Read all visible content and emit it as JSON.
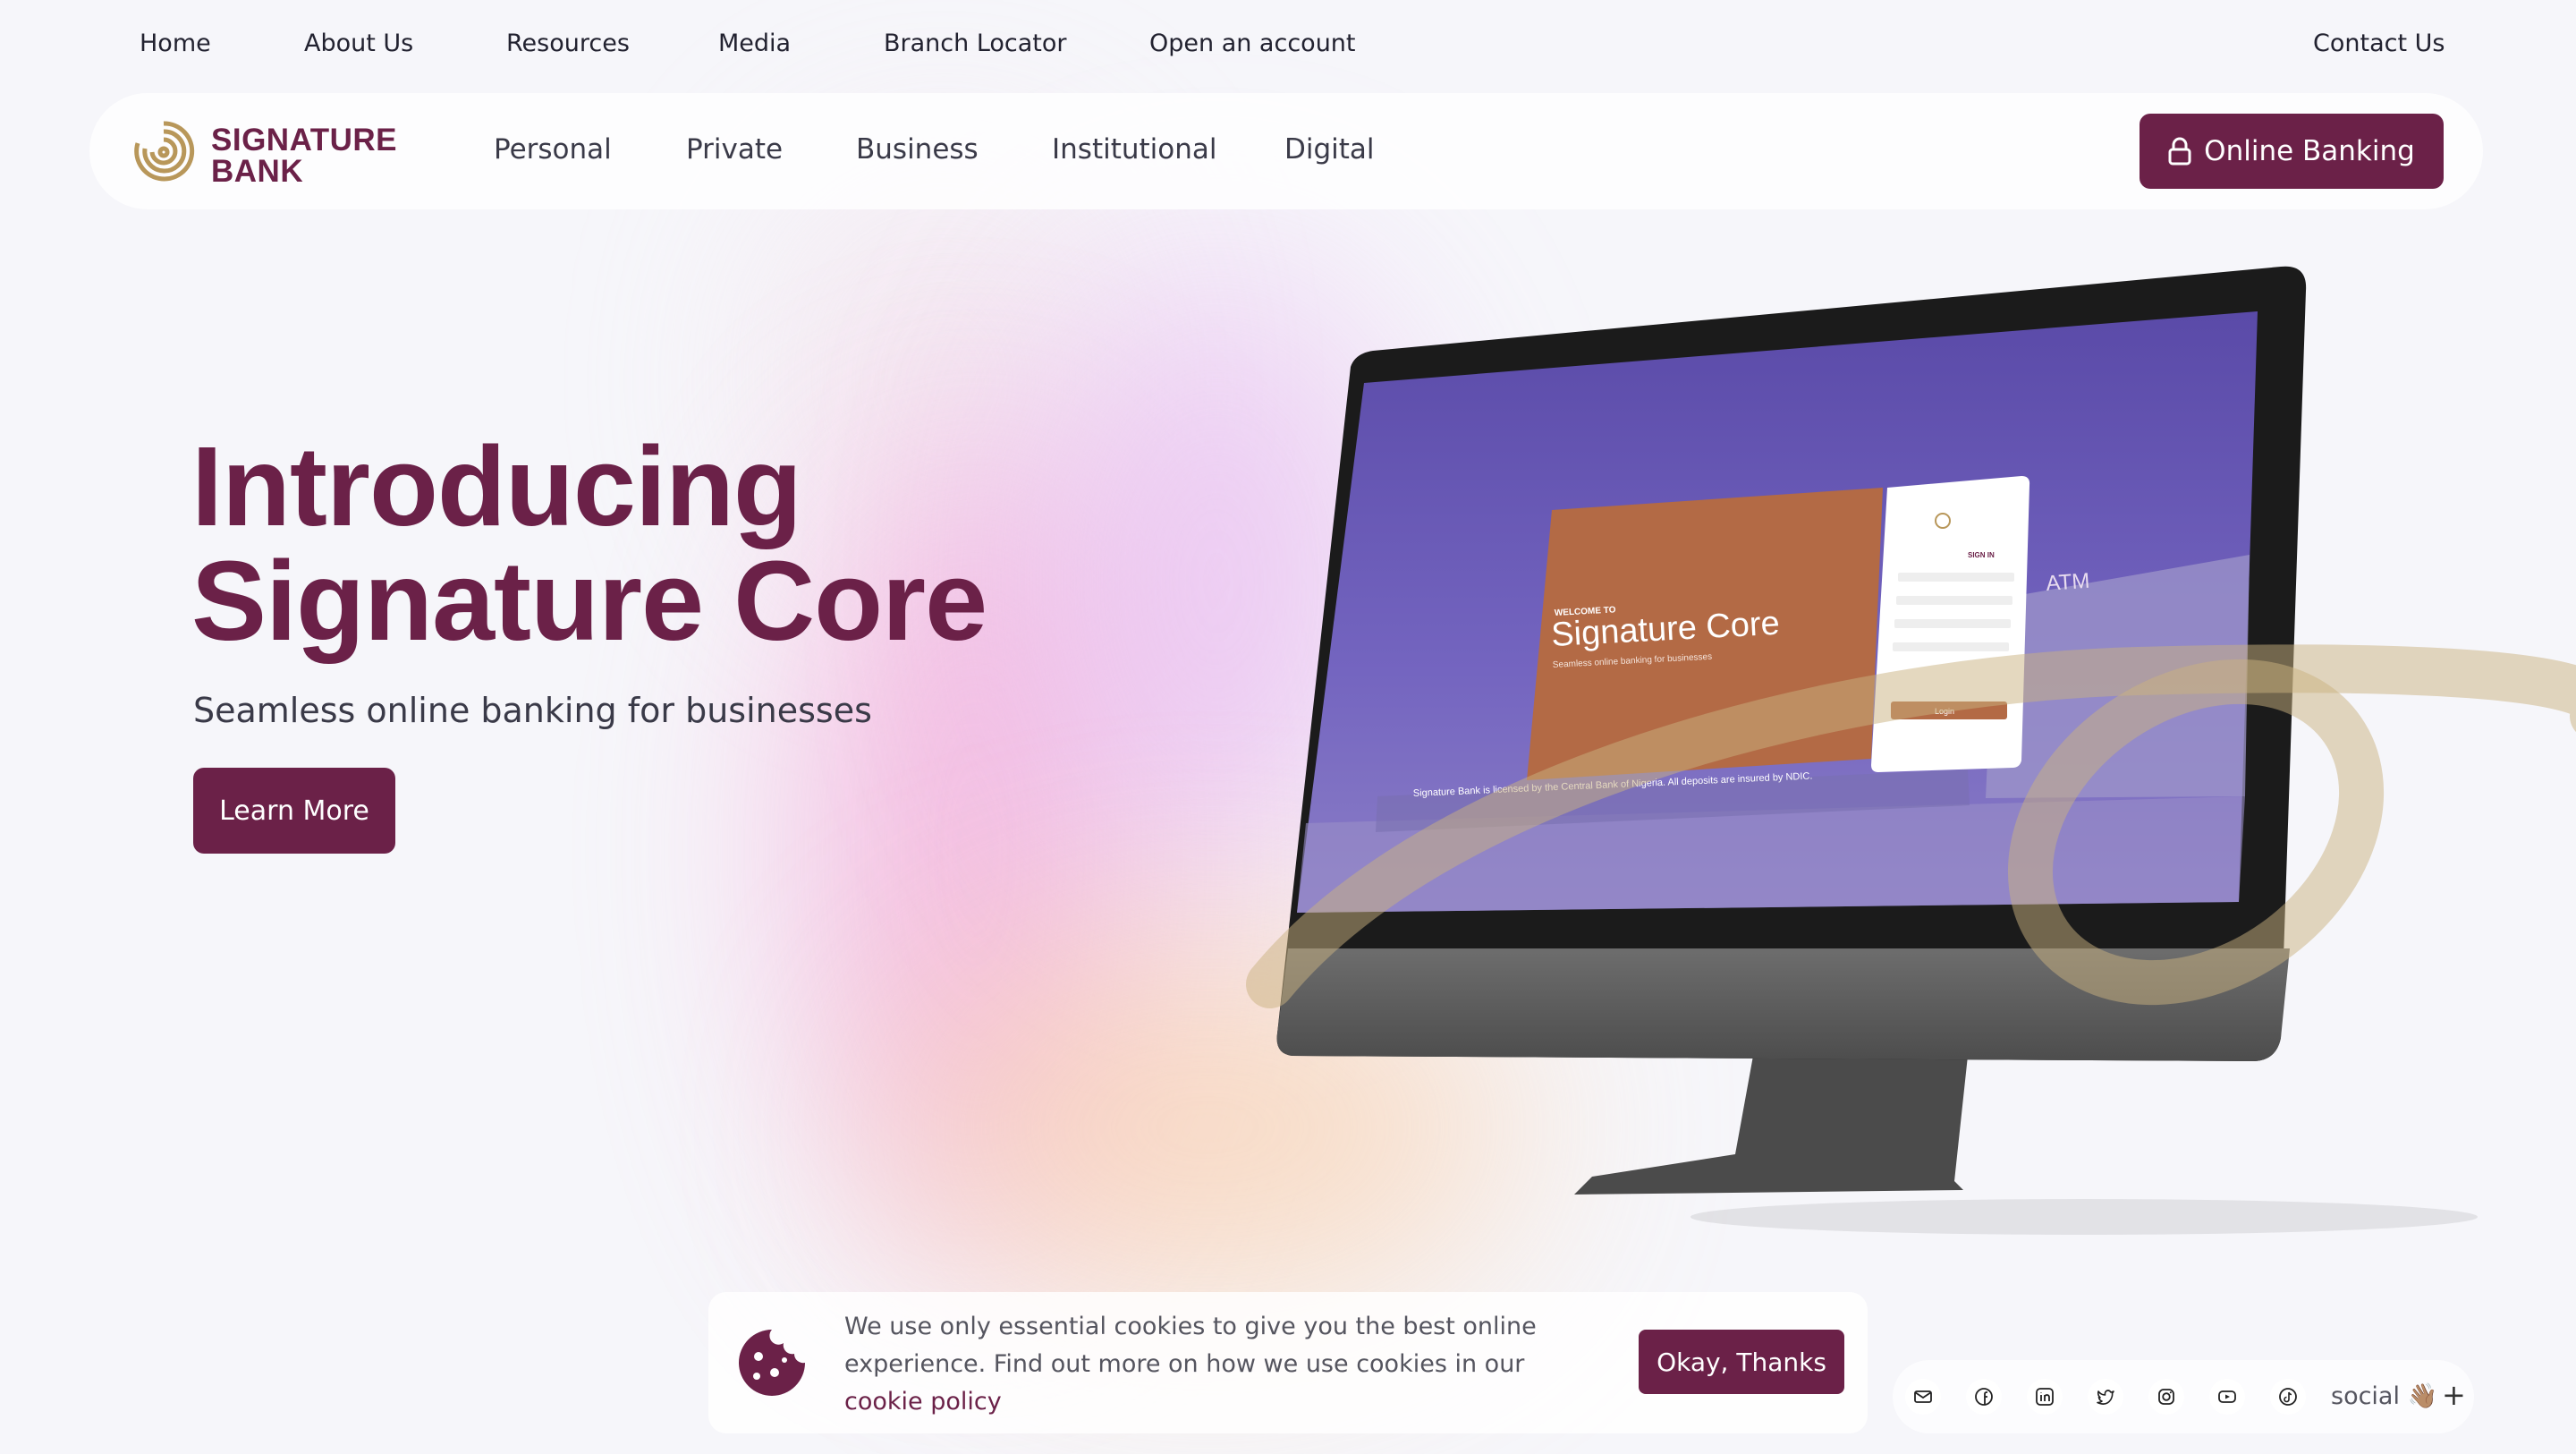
{
  "topbar": {
    "links": [
      "Home",
      "About Us",
      "Resources",
      "Media",
      "Branch Locator",
      "Open an account"
    ],
    "contact": "Contact Us"
  },
  "brand": {
    "line1": "SIGNATURE",
    "line2": "BANK"
  },
  "nav": {
    "items": [
      "Personal",
      "Private",
      "Business",
      "Institutional",
      "Digital"
    ],
    "online_banking": "Online Banking"
  },
  "hero": {
    "title_line1": "Introducing",
    "title_line2": "Signature Core",
    "subtitle": "Seamless online banking for businesses",
    "cta": "Learn More"
  },
  "screen": {
    "welcome": "WELCOME TO",
    "product": "Signature Core",
    "tagline": "Seamless online banking for businesses",
    "atm": "ATM",
    "signin": "SIGN IN",
    "login": "Login",
    "footer": "Signature Bank is licensed by the Central Bank of Nigeria. All deposits are insured by NDIC."
  },
  "cookie": {
    "text": "We use only essential cookies to give you the best online experience. Find out more on how we use cookies in our",
    "link": "cookie policy",
    "button": "Okay, Thanks"
  },
  "social": {
    "label": "social 👋🏽",
    "icons": [
      "mail-icon",
      "facebook-icon",
      "linkedin-icon",
      "twitter-icon",
      "instagram-icon",
      "youtube-icon",
      "tiktok-icon"
    ]
  },
  "colors": {
    "brand": "#6b2148",
    "gold": "#b8975a",
    "screen": "#6a5bb5"
  }
}
